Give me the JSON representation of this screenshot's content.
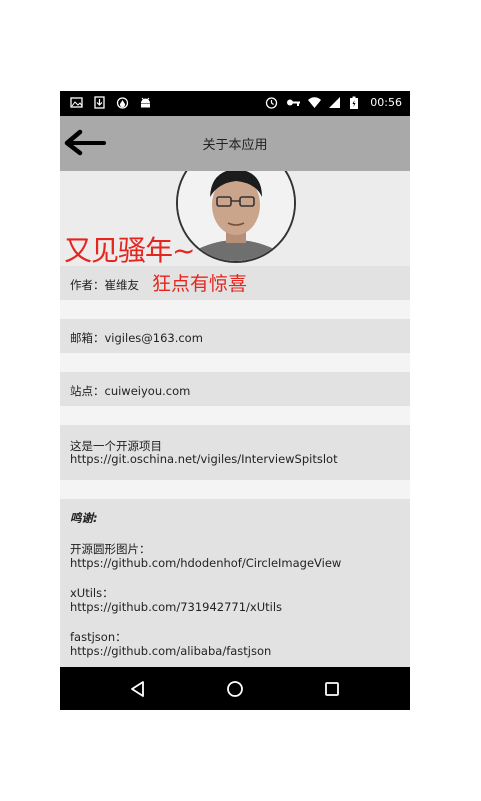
{
  "status": {
    "time": "00:56",
    "left_icons": [
      "image-icon",
      "download-icon",
      "water-drop-icon",
      "android-icon"
    ],
    "right_icons": [
      "alarm-icon",
      "key-icon",
      "wifi-icon",
      "signal-icon",
      "battery-icon"
    ]
  },
  "appbar": {
    "title": "关于本应用"
  },
  "overlay": {
    "big_text": "又见骚年~",
    "red_text": "狂点有惊喜"
  },
  "author": {
    "label": "作者：崔维友"
  },
  "email": {
    "label": "邮箱：vigiles@163.com"
  },
  "site": {
    "label": "站点：cuiweiyou.com"
  },
  "project": {
    "line1": "这是一个开源项目",
    "line2": "https://git.oschina.net/vigiles/InterviewSpitslot"
  },
  "thanks": {
    "heading": "鸣谢:",
    "items": [
      {
        "name": "开源圆形图片：",
        "url": "https://github.com/hdodenhof/CircleImageView"
      },
      {
        "name": "xUtils：",
        "url": "https://github.com/731942771/xUtils"
      },
      {
        "name": "fastjson：",
        "url": "https://github.com/alibaba/fastjson"
      }
    ]
  },
  "colors": {
    "accent_red": "#e5261f",
    "appbar": "#a9a9a9",
    "row": "#e2e2e2"
  }
}
